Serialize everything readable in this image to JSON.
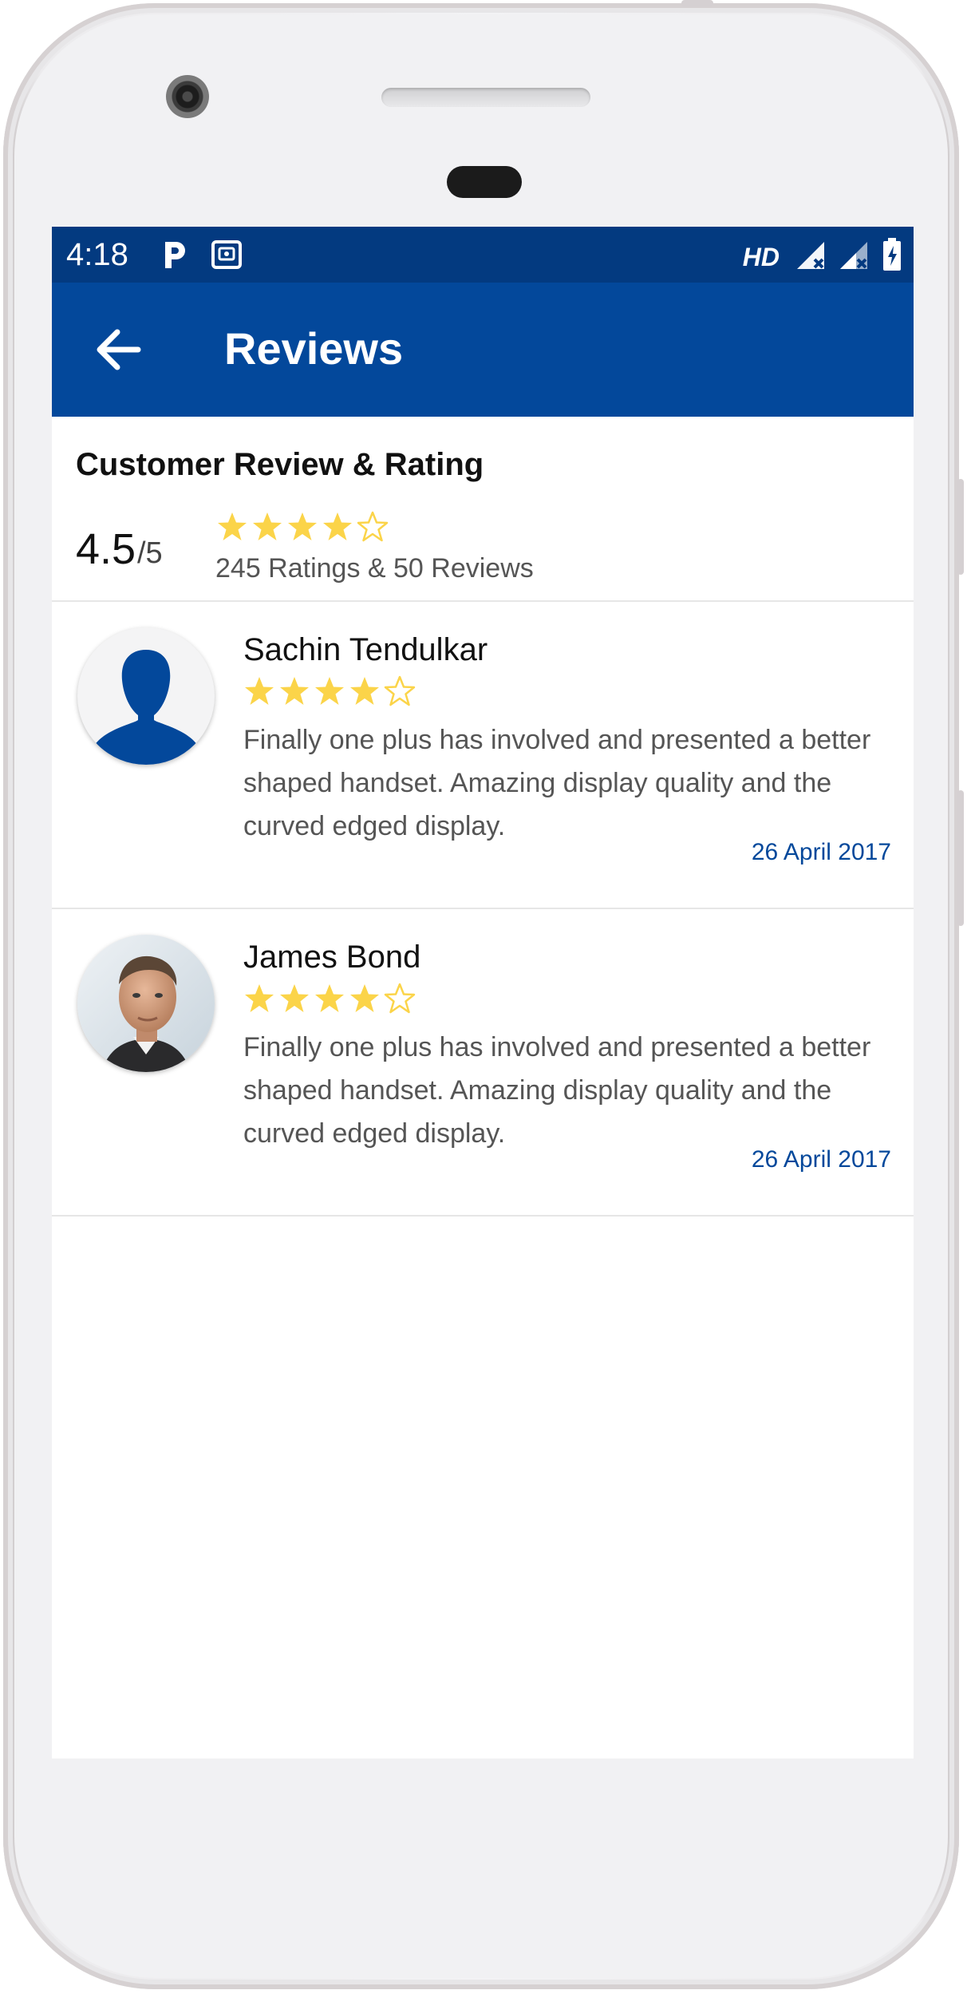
{
  "colors": {
    "status_bar": "#033a80",
    "app_bar": "#03489b",
    "star": "#fbd449",
    "date_text": "#03489b",
    "avatar_silhouette": "#03489b"
  },
  "status_bar": {
    "time": "4:18",
    "network_label": "HD",
    "icons": [
      "parking-icon",
      "sim-card-icon",
      "signal-1-icon",
      "signal-2-icon",
      "battery-charging-icon"
    ]
  },
  "app_bar": {
    "title": "Reviews",
    "back_icon": "arrow-back-icon"
  },
  "summary": {
    "heading": "Customer Review & Rating",
    "rating_value": "4.5",
    "rating_scale": "/5",
    "stars_filled": 4,
    "stars_total": 5,
    "counts_text": "245 Ratings & 50 Reviews"
  },
  "reviews": [
    {
      "name": "Sachin Tendulkar",
      "avatar": "default-user-silhouette",
      "stars_filled": 4,
      "stars_total": 5,
      "text": "Finally one plus has involved and presented a better shaped handset. Amazing display quality and the curved edged display.",
      "date": "26 April 2017"
    },
    {
      "name": "James Bond",
      "avatar": "user-photo",
      "stars_filled": 4,
      "stars_total": 5,
      "text": "Finally one plus has involved and presented a better shaped handset. Amazing display quality and the curved edged display.",
      "date": "26 April 2017"
    }
  ]
}
